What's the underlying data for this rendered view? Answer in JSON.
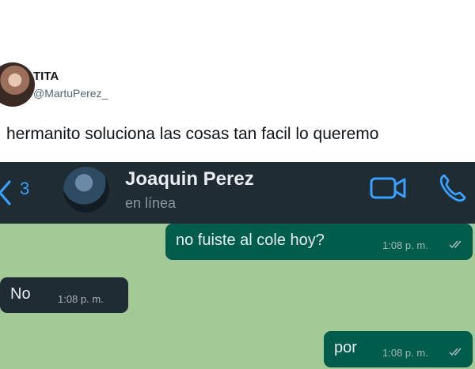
{
  "tweet": {
    "author_name": "TITA",
    "author_handle": "@MartuPerez_",
    "text": "hermanito soluciona las cosas tan facil lo queremo"
  },
  "chat_header": {
    "back_count": "3",
    "contact_name": "Joaquin Perez",
    "contact_status": "en línea",
    "icons": [
      "back-chevron-icon",
      "video-call-icon",
      "phone-call-icon"
    ],
    "accent": "#3aa0ff"
  },
  "messages": [
    {
      "direction": "out",
      "text": "no fuiste al cole hoy?",
      "time": "1:08 p. m."
    },
    {
      "direction": "in",
      "text": "No",
      "time": "1:08 p. m."
    },
    {
      "direction": "out",
      "text": "por",
      "time": "1:08 p. m."
    }
  ],
  "colors": {
    "chat_bg": "#a3c996",
    "outgoing_bubble": "#005c4b",
    "incoming_bubble": "#202c33",
    "header_bg": "#1f2c34"
  }
}
